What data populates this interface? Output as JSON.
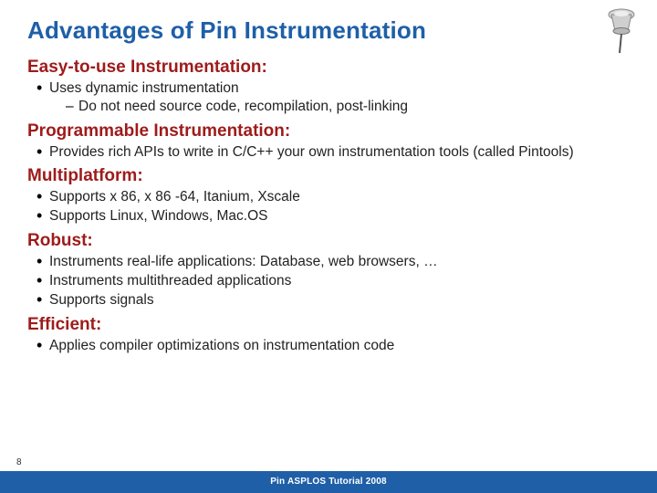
{
  "title": "Advantages of Pin Instrumentation",
  "sections": [
    {
      "heading": "Easy-to-use Instrumentation:",
      "bullets": [
        {
          "text": "Uses dynamic instrumentation",
          "sub": [
            "Do not need source code, recompilation, post-linking"
          ]
        }
      ]
    },
    {
      "heading": "Programmable Instrumentation:",
      "bullets": [
        {
          "text": "Provides rich APIs to write in C/C++ your own instrumentation tools (called Pintools)"
        }
      ]
    },
    {
      "heading": "Multiplatform:",
      "bullets": [
        {
          "text": "Supports x 86, x 86 -64, Itanium, Xscale"
        },
        {
          "text": "Supports Linux, Windows, Mac.OS"
        }
      ]
    },
    {
      "heading": "Robust:",
      "bullets": [
        {
          "text": "Instruments real-life applications: Database, web browsers, …"
        },
        {
          "text": "Instruments multithreaded applications"
        },
        {
          "text": "Supports signals"
        }
      ]
    },
    {
      "heading": "Efficient:",
      "bullets": [
        {
          "text": "Applies compiler optimizations on instrumentation code"
        }
      ]
    }
  ],
  "page_number": "8",
  "footer": "Pin ASPLOS Tutorial 2008"
}
